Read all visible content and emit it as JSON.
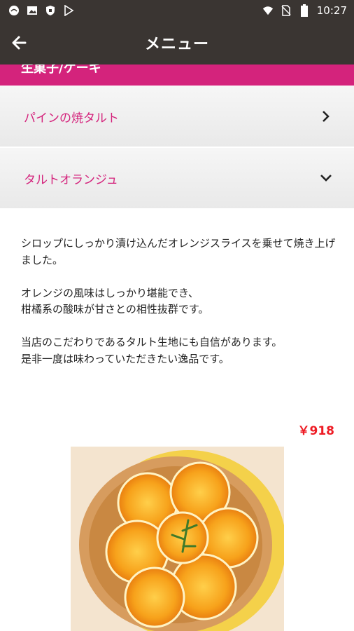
{
  "status_bar": {
    "time": "10:27",
    "icons": [
      "weather-icon",
      "image-icon",
      "shield-icon",
      "play-store-icon",
      "wifi-icon",
      "no-sim-icon",
      "battery-icon"
    ]
  },
  "app_bar": {
    "title": "メニュー"
  },
  "category": {
    "label": "生菓子/ケーキ"
  },
  "items": [
    {
      "label": "パインの焼タルト",
      "state": "collapsed"
    },
    {
      "label": "タルトオランジュ",
      "state": "expanded"
    }
  ],
  "detail": {
    "paragraphs": [
      "シロップにしっかり漬け込んだオレンジスライスを乗せて焼き上げました。",
      "オレンジの風味はしっかり堪能でき、\n柑橘系の酸味が甘さとの相性抜群です。",
      "当店のこだわりであるタルト生地にも自信があります。\n是非一度は味わっていただきたい逸品です。"
    ],
    "price": "￥918"
  },
  "colors": {
    "accent": "#d4237c",
    "price": "#ee1b24",
    "bar": "#3a3532"
  }
}
